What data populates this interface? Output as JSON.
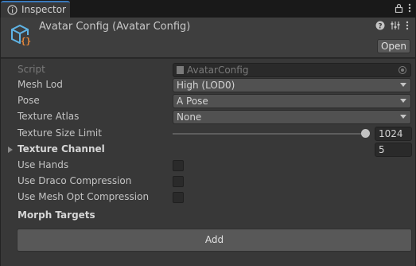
{
  "tab": {
    "label": "Inspector"
  },
  "header": {
    "title": "Avatar Config (Avatar Config)",
    "open_label": "Open"
  },
  "fields": {
    "script": {
      "label": "Script",
      "value": "AvatarConfig"
    },
    "mesh_lod": {
      "label": "Mesh Lod",
      "value": "High (LOD0)"
    },
    "pose": {
      "label": "Pose",
      "value": "A Pose"
    },
    "texture_atlas": {
      "label": "Texture Atlas",
      "value": "None"
    },
    "texture_size_limit": {
      "label": "Texture Size Limit",
      "value": "1024"
    },
    "texture_channel": {
      "label": "Texture Channel",
      "value": "5"
    },
    "use_hands": {
      "label": "Use Hands",
      "checked": false
    },
    "use_draco": {
      "label": "Use Draco Compression",
      "checked": false
    },
    "use_mesh_opt": {
      "label": "Use Mesh Opt Compression",
      "checked": false
    }
  },
  "morph_targets": {
    "label": "Morph Targets",
    "add_label": "Add"
  },
  "colors": {
    "panel_bg": "#383838",
    "tab_accent": "#3a79bb",
    "field_bg": "#515151",
    "icon_blue": "#5fb4e6",
    "icon_orange": "#e8883a"
  }
}
